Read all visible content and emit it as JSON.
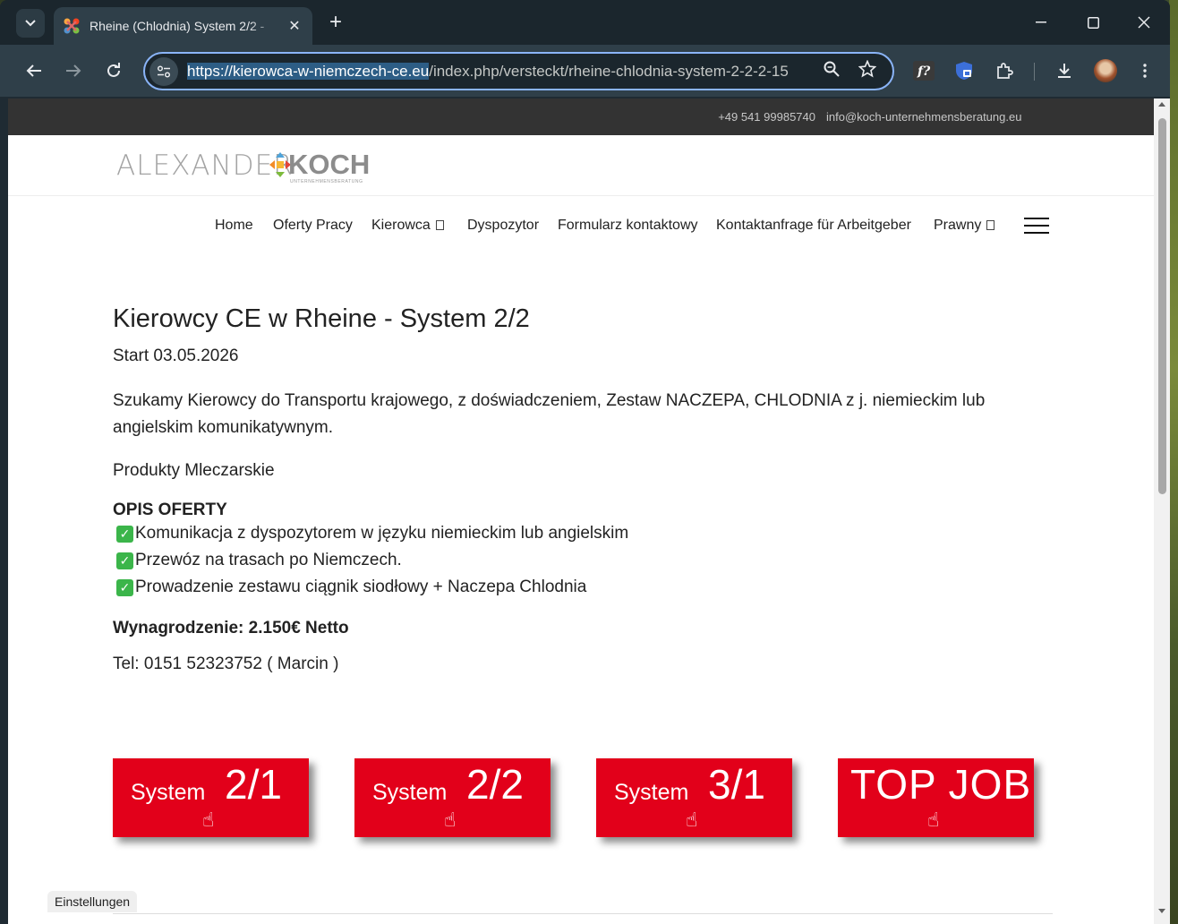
{
  "browser": {
    "tab_title": "Rheine (Chlodnia) System 2/2 -",
    "url_domain": "https://kierowca-w-niemczech-ce.eu",
    "url_path": "/index.php/versteckt/rheine-chlodnia-system-2-2-2-15"
  },
  "site": {
    "topbar_phone": "+49 541 99985740",
    "topbar_email": "info@koch-unternehmensberatung.eu",
    "logo_left": "ALEXANDER",
    "logo_right": "KOCH",
    "logo_sub": "UNTERNEHMENSBERATUNG"
  },
  "nav": {
    "items": [
      {
        "label": "Home"
      },
      {
        "label": "Oferty Pracy"
      },
      {
        "label": "Kierowca"
      },
      {
        "label": "Dyspozytor"
      },
      {
        "label": "Formularz kontaktowy"
      },
      {
        "label": "Kontaktanfrage für Arbeitgeber"
      },
      {
        "label": "Prawny"
      }
    ]
  },
  "content": {
    "title": "Kierowcy CE w Rheine - System 2/2",
    "start": "Start 03.05.2026",
    "description": "Szukamy Kierowcy do Transportu krajowego, z doświadczeniem, Zestaw NACZEPA, CHLODNIA z j. niemieckim lub angielskim komunikatywnym.",
    "products": "Produkty Mleczarskie",
    "offer_title": "OPIS OFERTY",
    "offer_items": [
      "Komunikacja z dyspozytorem w języku niemieckim lub angielskim",
      "Przewóz na trasach po Niemczech.",
      "Prowadzenie zestawu ciągnik siodłowy + Naczepa Chlodnia"
    ],
    "salary": "Wynagrodzenie: 2.150€ Netto",
    "tel": "Tel: 0151 52323752 ( Marcin )"
  },
  "cards": [
    {
      "small": "System",
      "big": "2/1"
    },
    {
      "small": "System",
      "big": "2/2"
    },
    {
      "small": "System",
      "big": "3/1"
    },
    {
      "small": "",
      "big": "TOP JOB"
    }
  ],
  "settings_label": "Einstellungen",
  "colors": {
    "accent_red": "#e2001a",
    "topbar_bg": "#333333",
    "omnibox_focus": "#8ab4f8"
  }
}
